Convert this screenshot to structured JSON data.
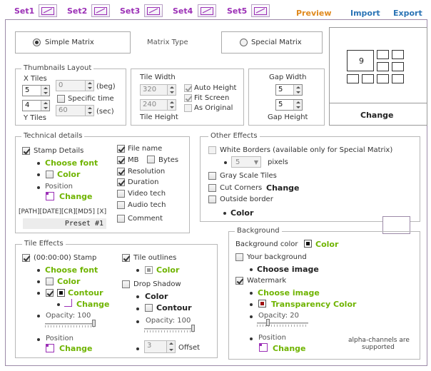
{
  "sets": [
    {
      "label": "Set1"
    },
    {
      "label": "Set2"
    },
    {
      "label": "Set3"
    },
    {
      "label": "Set4"
    },
    {
      "label": "Set5"
    }
  ],
  "toplinks": {
    "preview": "Preview",
    "import": "Import",
    "export": "Export"
  },
  "matrix": {
    "simple": "Simple Matrix",
    "type": "Matrix Type",
    "special": "Special Matrix",
    "change": "Change",
    "preview_number": "9"
  },
  "layout": {
    "title": "Thumbnails Layout",
    "x_tiles": "X Tiles",
    "x_value": "5",
    "y_tiles": "Y Tiles",
    "y_value": "4",
    "beg_value": "0",
    "beg": "(beg)",
    "specific_time": "Specific time",
    "sec_value": "60",
    "sec": "(sec)"
  },
  "tile": {
    "width": "Tile Width",
    "width_value": "320",
    "height": "Tile Height",
    "height_value": "240",
    "auto_height": "Auto Height",
    "fit_screen": "Fit Screen",
    "as_original": "As Original"
  },
  "gap": {
    "width": "Gap Width",
    "width_value": "5",
    "height_value": "5",
    "height": "Gap Height"
  },
  "technical": {
    "title": "Technical details",
    "stamp_details": "Stamp Details",
    "choose_font": "Choose font",
    "color": "Color",
    "position": "Position",
    "change": "Change",
    "file_name": "File name",
    "mb": "MB",
    "bytes": "Bytes",
    "resolution": "Resolution",
    "duration": "Duration",
    "video_tech": "Video tech",
    "audio_tech": "Audio tech",
    "comment": "Comment",
    "template": "[PATH][DATE][CR][MD5] [X]",
    "preset": "Preset #1"
  },
  "other": {
    "title": "Other Effects",
    "white_borders": "White Borders (available only for Special Matrix)",
    "pixels_value": "5",
    "pixels": "pixels",
    "gray_scale": "Gray Scale Tiles",
    "cut_corners": "Cut Corners",
    "change": "Change",
    "outside_border": "Outside border",
    "color": "Color"
  },
  "tile_effects": {
    "title": "Tile Effects",
    "stamp": "(00:00:00) Stamp",
    "choose_font": "Choose font",
    "color": "Color",
    "contour": "Contour",
    "change": "Change",
    "opacity": "Opacity: 100",
    "position": "Position",
    "position_change": "Change",
    "tile_outlines": "Tile outlines",
    "outline_color": "Color",
    "drop_shadow": "Drop Shadow",
    "shadow_color": "Color",
    "shadow_contour": "Contour",
    "shadow_opacity": "Opacity: 100",
    "offset_value": "3",
    "offset": "Offset"
  },
  "background": {
    "title": "Background",
    "bg_color": "Background color",
    "color": "Color",
    "your_background": "Your background",
    "choose_image": "Choose image",
    "watermark": "Watermark",
    "wm_choose_image": "Choose image",
    "transparency": "Transparency Color",
    "opacity": "Opacity: 20",
    "position": "Position",
    "change": "Change",
    "alpha_note_1": "alpha-channels are",
    "alpha_note_2": "supported"
  },
  "colors": {
    "purple": "#9b2fb6",
    "green": "#6fb400",
    "blue": "#2a74b5",
    "orange": "#e08a1e"
  }
}
